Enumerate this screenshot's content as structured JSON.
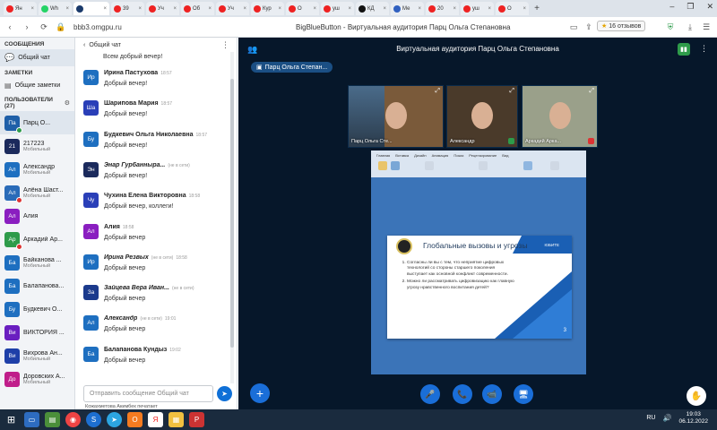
{
  "browser": {
    "tabs": [
      {
        "label": "Ян",
        "color": "#e22"
      },
      {
        "label": "Wh",
        "color": "#25d366"
      },
      {
        "label": "",
        "color": "#1a3a6b",
        "active": true
      },
      {
        "label": "39",
        "color": "#e22"
      },
      {
        "label": "Уч",
        "color": "#e22"
      },
      {
        "label": "Об",
        "color": "#e22"
      },
      {
        "label": "Уч",
        "color": "#e22"
      },
      {
        "label": "Кур",
        "color": "#e22"
      },
      {
        "label": "О",
        "color": "#e22"
      },
      {
        "label": "уш",
        "color": "#e22"
      },
      {
        "label": "КД",
        "color": "#111"
      },
      {
        "label": "Ме",
        "color": "#3060c0"
      },
      {
        "label": "20",
        "color": "#e22"
      },
      {
        "label": "уш",
        "color": "#e22"
      },
      {
        "label": "О",
        "color": "#e22"
      }
    ],
    "url": "bbb3.omgpu.ru",
    "page_title": "BigBlueButton - Виртуальная аудитория Парц Ольга Степановна",
    "reviews": "16 отзывов"
  },
  "sidebar": {
    "messages_header": "СООБЩЕНИЯ",
    "public_chat": "Общий чат",
    "notes_header": "ЗАМЕТКИ",
    "shared_notes": "Общие заметки",
    "users_header": "ПОЛЬЗОВАТЕЛИ (27)",
    "users": [
      {
        "initials": "Па",
        "name": "Парц О...",
        "sub": "",
        "color": "#1e5fa8",
        "dot": "#2e9b4a",
        "sel": true
      },
      {
        "initials": "21",
        "name": "217223",
        "sub": "Мобильный",
        "color": "#1b2a5c",
        "dot": ""
      },
      {
        "initials": "Ал",
        "name": "Александр",
        "sub": "Мобильный",
        "color": "#1e6fc0",
        "dot": ""
      },
      {
        "initials": "Ал",
        "name": "Алёна Шаст...",
        "sub": "Мобильный",
        "color": "#2a6bb8",
        "dot": "#d33"
      },
      {
        "initials": "Ал",
        "name": "Алия",
        "sub": "",
        "color": "#8a1ec0",
        "dot": ""
      },
      {
        "initials": "Ар",
        "name": "Аркадий Ар...",
        "sub": "",
        "color": "#2e9b4a",
        "dot": "#d33"
      },
      {
        "initials": "Ба",
        "name": "Байканова ...",
        "sub": "Мобильный",
        "color": "#1e6fc0",
        "dot": ""
      },
      {
        "initials": "Ба",
        "name": "Балапанова...",
        "sub": "",
        "color": "#1e6fc0",
        "dot": ""
      },
      {
        "initials": "Бу",
        "name": "Будкевич О...",
        "sub": "",
        "color": "#1e6fc0",
        "dot": ""
      },
      {
        "initials": "Ви",
        "name": "ВИКТОРИЯ ...",
        "sub": "",
        "color": "#6a1ec0",
        "dot": ""
      },
      {
        "initials": "Ви",
        "name": "Вихрова Ан...",
        "sub": "Мобильный",
        "color": "#1e3fa8",
        "dot": ""
      },
      {
        "initials": "До",
        "name": "Доровских А...",
        "sub": "Мобильный",
        "color": "#c01e8a",
        "dot": ""
      }
    ]
  },
  "chat": {
    "title": "Общий чат",
    "first_text": "Всем добрый вечер!",
    "messages": [
      {
        "initials": "Ир",
        "name": "Ирина Пастухова",
        "time": "18:57",
        "text": "Добрый вечер!",
        "color": "#1e6fc0",
        "note": "",
        "italic": false
      },
      {
        "initials": "Ша",
        "name": "Шарипова Мария",
        "time": "18:57",
        "text": "Добрый вечер!",
        "color": "#2a3fb8",
        "note": "",
        "italic": false
      },
      {
        "initials": "Бу",
        "name": "Будкевич Ольга Николаевна",
        "time": "18:57",
        "text": "Добрый вечер!",
        "color": "#1e6fc0",
        "note": "",
        "italic": false
      },
      {
        "initials": "Эн",
        "name": "Энар Гурбанныра...",
        "time": "",
        "text": "Добрый вечер!",
        "color": "#1b2a5c",
        "note": "(не в сети)",
        "italic": true
      },
      {
        "initials": "Чу",
        "name": "Чухина Елена Викторовна",
        "time": "18:58",
        "text": "Добрый вечер, коллеги!",
        "color": "#2a3fb8",
        "note": "",
        "italic": false
      },
      {
        "initials": "Ал",
        "name": "Алия",
        "time": "18:58",
        "text": "Добрый вечер",
        "color": "#8a1ec0",
        "note": "",
        "italic": false
      },
      {
        "initials": "Ир",
        "name": "Ирина Резвых",
        "time": "18:58",
        "text": "Добрый вечер",
        "color": "#1e6fc0",
        "note": "(не в сети)",
        "italic": true
      },
      {
        "initials": "За",
        "name": "Зайцева Вера Иван...",
        "time": "",
        "text": "Добрый вечер",
        "color": "#1b3a8c",
        "note": "(не в сети)",
        "italic": true
      },
      {
        "initials": "Ал",
        "name": "Александр",
        "time": "19:01",
        "text": "Добрый вечер",
        "color": "#1e6fc0",
        "note": "(не в сети)",
        "italic": true
      },
      {
        "initials": "Ба",
        "name": "Балапанова Кундыз",
        "time": "19:02",
        "text": "Добрый вечер",
        "color": "#1e6fc0",
        "note": "",
        "italic": false
      }
    ],
    "input_placeholder": "Отправить сообщение Общий чат",
    "typing": "Кожахметова Акимбек печатает"
  },
  "main": {
    "title": "Виртуальная аудитория Парц Ольга Степановна",
    "presenter": "Парц Ольга Степан...",
    "videos": [
      {
        "name": "Парц Ольга Сте...",
        "bg": "#7a5a3a",
        "mic": ""
      },
      {
        "name": "Александр",
        "bg": "#4a3a2a",
        "mic": "#2e9b4a"
      },
      {
        "name": "Аркадий Арка...",
        "bg": "#9aa08a",
        "mic": "#d33"
      }
    ],
    "slide": {
      "ribbon_tabs": [
        "Главная",
        "Вставка",
        "Дизайн",
        "Анимация",
        "Показ",
        "Рецензирование",
        "Вид"
      ],
      "title": "Глобальные вызовы и угрозы",
      "badge": "ЮБИТЕ",
      "items": [
        "Согласны ли вы с тем, что неприятие цифровых технологий со стороны старшего поколения выступает как основной конфликт современности.",
        "Можно ли рассматривать цифровизацию как главную угрозу нравственного воспитания детей?"
      ],
      "number": "3"
    }
  },
  "taskbar": {
    "lang": "RU",
    "time": "19:03",
    "date": "06.12.2022"
  }
}
